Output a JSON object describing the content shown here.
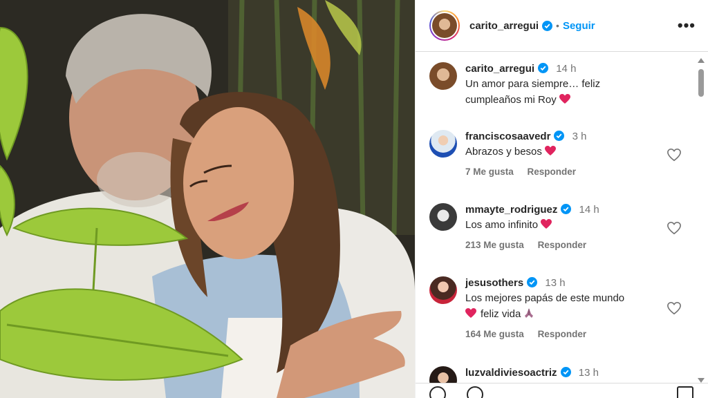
{
  "post": {
    "author": "carito_arregui",
    "follow_label": "Seguir",
    "separator": "•",
    "more_label": "•••"
  },
  "caption": {
    "username": "carito_arregui",
    "time": "14 h",
    "text_line1": "Un amor para siempre… feliz",
    "text_line2": "cumpleaños mi Roy"
  },
  "comments": [
    {
      "username": "franciscosaavedr",
      "time": "3 h",
      "text": "Abrazos y besos",
      "likes": "7 Me gusta",
      "reply": "Responder"
    },
    {
      "username": "mmayte_rodriguez",
      "time": "14 h",
      "text": "Los amo infinito",
      "likes": "213 Me gusta",
      "reply": "Responder"
    },
    {
      "username": "jesusothers",
      "time": "13 h",
      "text_line1": "Los mejores papás de este mundo",
      "text_line2": "feliz vida",
      "likes": "164 Me gusta",
      "reply": "Responder"
    },
    {
      "username": "luzvaldiviesoactriz",
      "time": "13 h"
    }
  ],
  "colors": {
    "accent": "#0095f6",
    "verified": "#0095f6",
    "heart": "#e0245e",
    "muted": "#737373"
  },
  "icons": [
    "verified-badge-icon",
    "heart-outline-icon",
    "heart-emoji-icon",
    "praying-hands-emoji-icon",
    "more-options-icon"
  ]
}
